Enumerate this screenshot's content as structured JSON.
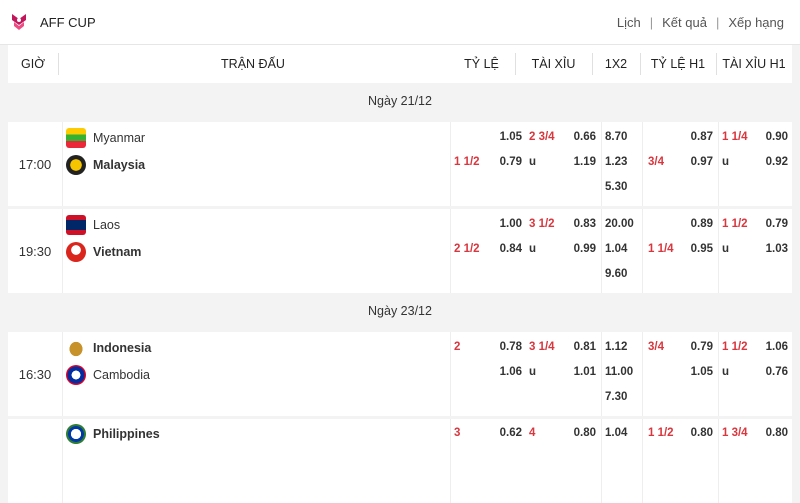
{
  "header": {
    "league": "AFF CUP",
    "links": [
      "Lịch",
      "Kết quả",
      "Xếp hạng"
    ],
    "colors": {
      "accent": "#d9363e",
      "logo": "#c2185b"
    }
  },
  "columns": {
    "gio": "GIỜ",
    "tran_dau": "TRẬN ĐẤU",
    "ty_le": "TỶ LỆ",
    "tai_xiu": "TÀI XỈU",
    "x12": "1X2",
    "ty_le_h1": "TỶ LỆ H1",
    "tai_xiu_h1": "TÀI XỈU H1"
  },
  "groups": [
    {
      "date": "Ngày 21/12",
      "matches": [
        {
          "time": "17:00",
          "home": {
            "name": "Myanmar",
            "bold": false,
            "icon": "myanmar-flag-icon"
          },
          "away": {
            "name": "Malaysia",
            "bold": true,
            "icon": "malaysia-flag-icon"
          },
          "ty_le": {
            "line1": "",
            "line2": "1 1/2",
            "odd1": "1.05",
            "odd2": "0.79"
          },
          "tai_xiu": {
            "line": "2 3/4",
            "u": "u",
            "odd1": "0.66",
            "odd2": "1.19"
          },
          "x12": [
            "8.70",
            "1.23",
            "5.30"
          ],
          "ty_le_h1": {
            "line1": "",
            "line2": "3/4",
            "odd1": "0.87",
            "odd2": "0.97"
          },
          "tai_xiu_h1": {
            "line": "1 1/4",
            "u": "u",
            "odd1": "0.90",
            "odd2": "0.92"
          }
        },
        {
          "time": "19:30",
          "home": {
            "name": "Laos",
            "bold": false,
            "icon": "laos-flag-icon"
          },
          "away": {
            "name": "Vietnam",
            "bold": true,
            "icon": "vietnam-flag-icon"
          },
          "ty_le": {
            "line1": "",
            "line2": "2 1/2",
            "odd1": "1.00",
            "odd2": "0.84"
          },
          "tai_xiu": {
            "line": "3 1/2",
            "u": "u",
            "odd1": "0.83",
            "odd2": "0.99"
          },
          "x12": [
            "20.00",
            "1.04",
            "9.60"
          ],
          "ty_le_h1": {
            "line1": "",
            "line2": "1 1/4",
            "odd1": "0.89",
            "odd2": "0.95"
          },
          "tai_xiu_h1": {
            "line": "1 1/2",
            "u": "u",
            "odd1": "0.79",
            "odd2": "1.03"
          }
        }
      ]
    },
    {
      "date": "Ngày 23/12",
      "matches": [
        {
          "time": "16:30",
          "home": {
            "name": "Indonesia",
            "bold": true,
            "icon": "indonesia-flag-icon"
          },
          "away": {
            "name": "Cambodia",
            "bold": false,
            "icon": "cambodia-flag-icon"
          },
          "ty_le": {
            "line1": "2",
            "line2": "",
            "odd1": "0.78",
            "odd2": "1.06"
          },
          "tai_xiu": {
            "line": "3 1/4",
            "u": "u",
            "odd1": "0.81",
            "odd2": "1.01"
          },
          "x12": [
            "1.12",
            "11.00",
            "7.30"
          ],
          "ty_le_h1": {
            "line1": "3/4",
            "line2": "",
            "odd1": "0.79",
            "odd2": "1.05"
          },
          "tai_xiu_h1": {
            "line": "1 1/2",
            "u": "u",
            "odd1": "1.06",
            "odd2": "0.76"
          }
        },
        {
          "time": "",
          "home": {
            "name": "Philippines",
            "bold": true,
            "icon": "philippines-flag-icon"
          },
          "away": {
            "name": "",
            "bold": false,
            "icon": ""
          },
          "ty_le": {
            "line1": "3",
            "line2": "",
            "odd1": "0.62",
            "odd2": ""
          },
          "tai_xiu": {
            "line": "4",
            "u": "",
            "odd1": "0.80",
            "odd2": ""
          },
          "x12": [
            "1.04",
            "",
            ""
          ],
          "ty_le_h1": {
            "line1": "1 1/2",
            "line2": "",
            "odd1": "0.80",
            "odd2": ""
          },
          "tai_xiu_h1": {
            "line": "1 3/4",
            "u": "",
            "odd1": "0.80",
            "odd2": ""
          }
        }
      ]
    }
  ]
}
